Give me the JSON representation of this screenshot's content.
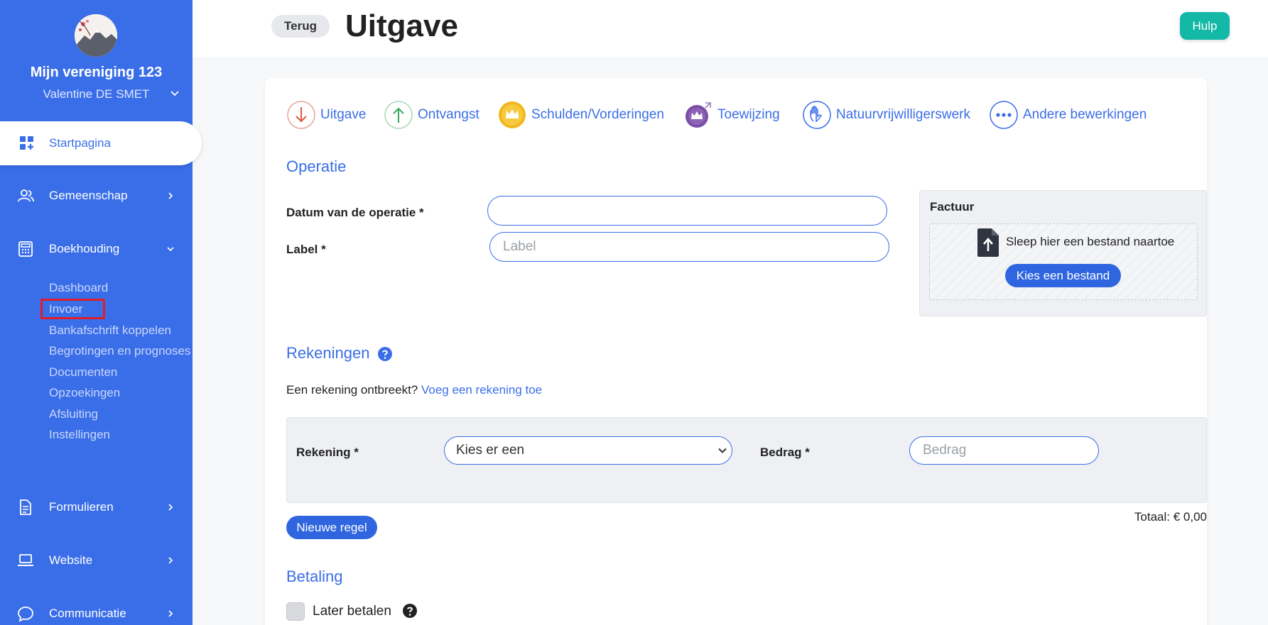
{
  "sidebar": {
    "org_name": "Mijn vereniging 123",
    "user_name": "Valentine DE SMET",
    "nav": {
      "home": "Startpagina",
      "community": "Gemeenschap",
      "accounting": "Boekhouding",
      "forms": "Formulieren",
      "website": "Website",
      "communication": "Communicatie"
    },
    "accounting_sub": [
      "Dashboard",
      "Invoer",
      "Bankafschrift koppelen",
      "Begrotingen en prognoses",
      "Documenten",
      "Opzoekingen",
      "Afsluiting",
      "Instellingen"
    ]
  },
  "header": {
    "back_label": "Terug",
    "title": "Uitgave",
    "help_label": "Hulp"
  },
  "operation_tabs": [
    "Uitgave",
    "Ontvangst",
    "Schulden/Vorderingen",
    "Toewijzing",
    "Natuurvrijwilligerswerk",
    "Andere bewerkingen"
  ],
  "operation": {
    "section_title": "Operatie",
    "date_label": "Datum van de operatie *",
    "date_value": "",
    "label_label": "Label *",
    "label_placeholder": "Label",
    "invoice": {
      "title": "Factuur",
      "drop_text": "Sleep hier een bestand naartoe",
      "choose_label": "Kies een bestand"
    }
  },
  "accounts": {
    "section_title": "Rekeningen",
    "missing_text": "Een rekening ontbreekt?",
    "add_link": "Voeg een rekening toe",
    "account_label": "Rekening *",
    "account_selected": "Kies er een",
    "amount_label": "Bedrag *",
    "amount_placeholder": "Bedrag",
    "new_line_label": "Nieuwe regel",
    "total": "Totaal: € 0,00"
  },
  "payment": {
    "section_title": "Betaling",
    "later_label": "Later betalen"
  },
  "colors": {
    "sidebar": "#3a6ee8",
    "accent": "#3a6ee8",
    "help_button": "#14b8a6",
    "highlight": "#e11d2a"
  }
}
